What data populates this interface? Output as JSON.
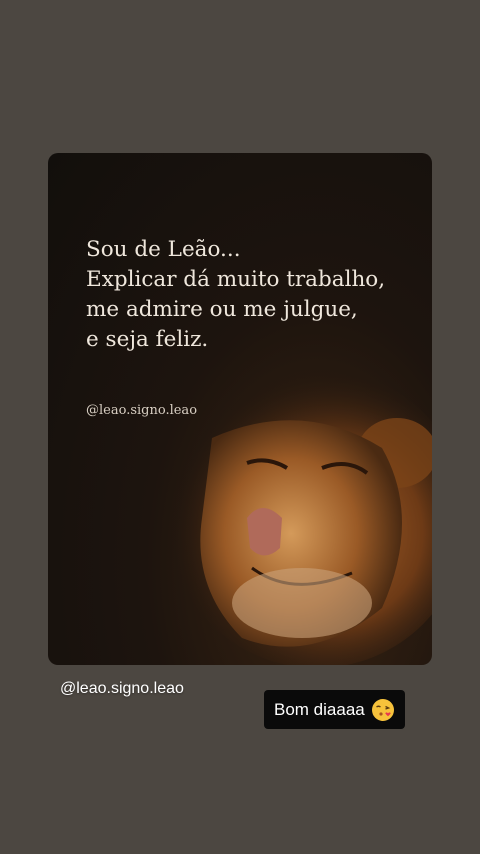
{
  "post": {
    "quote_lines": [
      "Sou de Leão...",
      "Explicar dá muito trabalho,",
      "me admire ou me julgue,",
      "e seja feliz."
    ],
    "card_handle": "@leao.signo.leao",
    "image_subject": "lion-icon"
  },
  "stickers": {
    "mention": "@leao.signo.leao",
    "caption": "Bom diaaaa",
    "emoji_icon": "face-blowing-kiss-icon"
  },
  "colors": {
    "background": "#4c4741",
    "text_light": "#efe7dc",
    "caption_bg": "#0a0a0a",
    "mane": "#8a4a1c"
  }
}
